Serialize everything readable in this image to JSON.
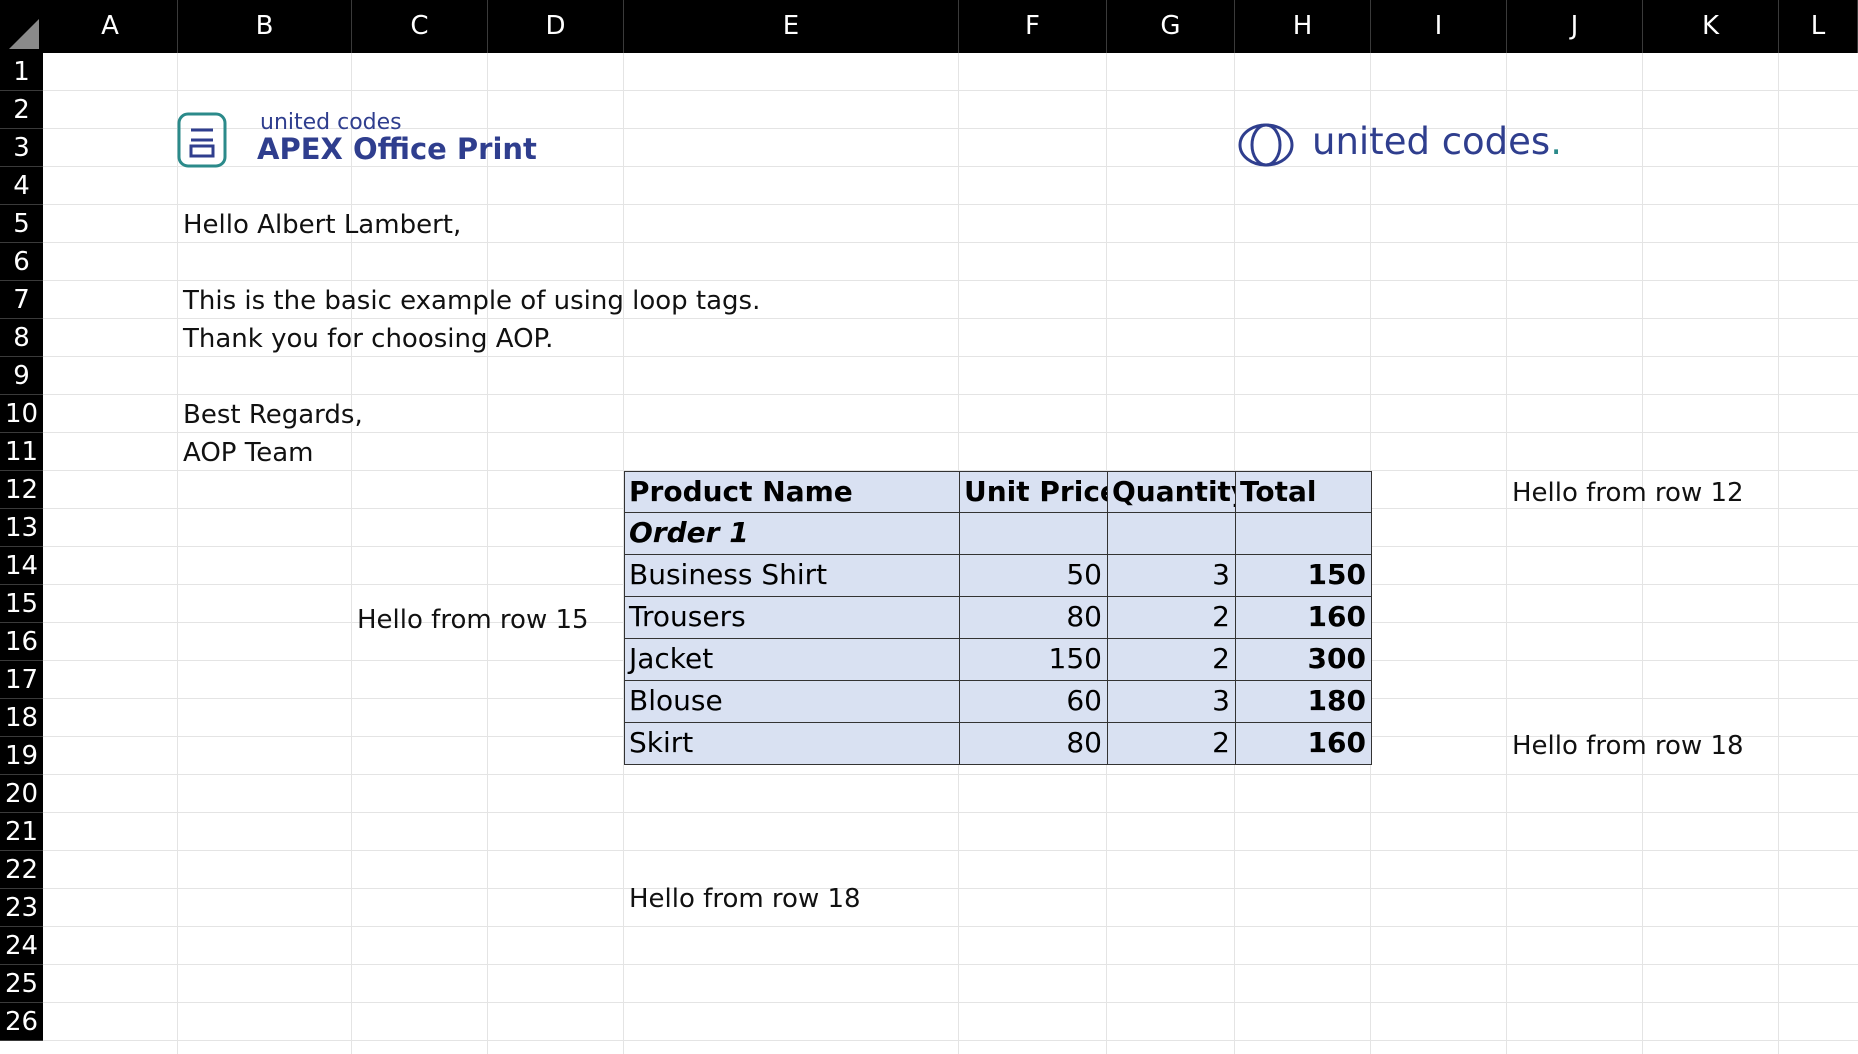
{
  "columns": [
    "A",
    "B",
    "C",
    "D",
    "E",
    "F",
    "G",
    "H",
    "I",
    "J",
    "K",
    "L"
  ],
  "rows": [
    "1",
    "2",
    "3",
    "4",
    "5",
    "6",
    "7",
    "8",
    "9",
    "10",
    "11",
    "12",
    "13",
    "14",
    "15",
    "16",
    "17",
    "18",
    "19",
    "20",
    "21",
    "22",
    "23",
    "24",
    "25",
    "26"
  ],
  "logos": {
    "aop_small": "united codes",
    "aop_big": "APEX Office Print",
    "brand": "united codes",
    "brand_dot": "."
  },
  "letter": {
    "greeting": "Hello Albert Lambert,",
    "line1": "This is the basic example of using loop tags.",
    "line2": "Thank you for choosing AOP.",
    "closing": "Best Regards,",
    "sign": "AOP Team"
  },
  "table": {
    "headers": [
      "Product Name",
      "Unit Price",
      "Quantity",
      "Total"
    ],
    "group": "Order 1",
    "rows": [
      {
        "name": "Business Shirt",
        "price": "50",
        "qty": "3",
        "total": "150"
      },
      {
        "name": "Trousers",
        "price": "80",
        "qty": "2",
        "total": "160"
      },
      {
        "name": "Jacket",
        "price": "150",
        "qty": "2",
        "total": "300"
      },
      {
        "name": "Blouse",
        "price": "60",
        "qty": "3",
        "total": "180"
      },
      {
        "name": "Skirt",
        "price": "80",
        "qty": "2",
        "total": "160"
      }
    ]
  },
  "notes": {
    "row12": "Hello from row 12",
    "row15": "Hello from row 15",
    "row18_right": "Hello from row 18",
    "row22": "Hello from row 18"
  },
  "colors": {
    "table_fill": "#d9e1f2",
    "logo_blue": "#2f3e8e",
    "logo_teal": "#2b8a8a"
  }
}
